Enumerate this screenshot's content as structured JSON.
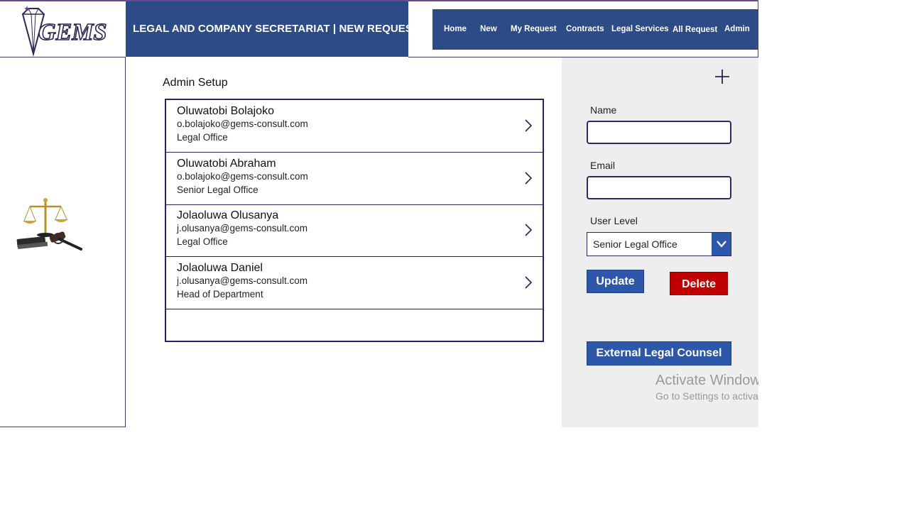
{
  "brand": {
    "logo_text": "GEMS",
    "page_title": "LEGAL AND COMPANY SECRETARIAT | NEW REQUEST"
  },
  "nav": {
    "items": [
      {
        "label": "Home"
      },
      {
        "label": "New"
      },
      {
        "label": "My Request"
      },
      {
        "label": "Contracts"
      },
      {
        "label": "Legal Services"
      },
      {
        "label": "All Request"
      },
      {
        "label": "Admin"
      }
    ]
  },
  "main": {
    "section_title": "Admin Setup",
    "users": [
      {
        "name": "Oluwatobi Bolajoko",
        "email": "o.bolajoko@gems-consult.com",
        "office": "Legal Office"
      },
      {
        "name": "Oluwatobi Abraham",
        "email": "o.bolajoko@gems-consult.com",
        "office": "Senior Legal Office"
      },
      {
        "name": "Jolaoluwa Olusanya",
        "email": "j.olusanya@gems-consult.com",
        "office": "Legal Office"
      },
      {
        "name": "Jolaoluwa Daniel",
        "email": "j.olusanya@gems-consult.com",
        "office": "Head of Department"
      }
    ]
  },
  "form": {
    "add_icon": "plus-icon",
    "name_label": "Name",
    "name_value": "",
    "email_label": "Email",
    "email_value": "",
    "user_level_label": "User Level",
    "user_level_value": "Senior Legal Office",
    "update_label": "Update",
    "delete_label": "Delete",
    "external_label": "External Legal Counsel"
  },
  "watermark": {
    "line1": "Activate Windows",
    "line2": "Go to Settings to activate Windows."
  },
  "colors": {
    "header_blue": "#2d4b86",
    "button_blue": "#2d57a8",
    "delete_red": "#c00000",
    "panel_grey": "#eeeeee",
    "border_navy": "#24245e"
  }
}
